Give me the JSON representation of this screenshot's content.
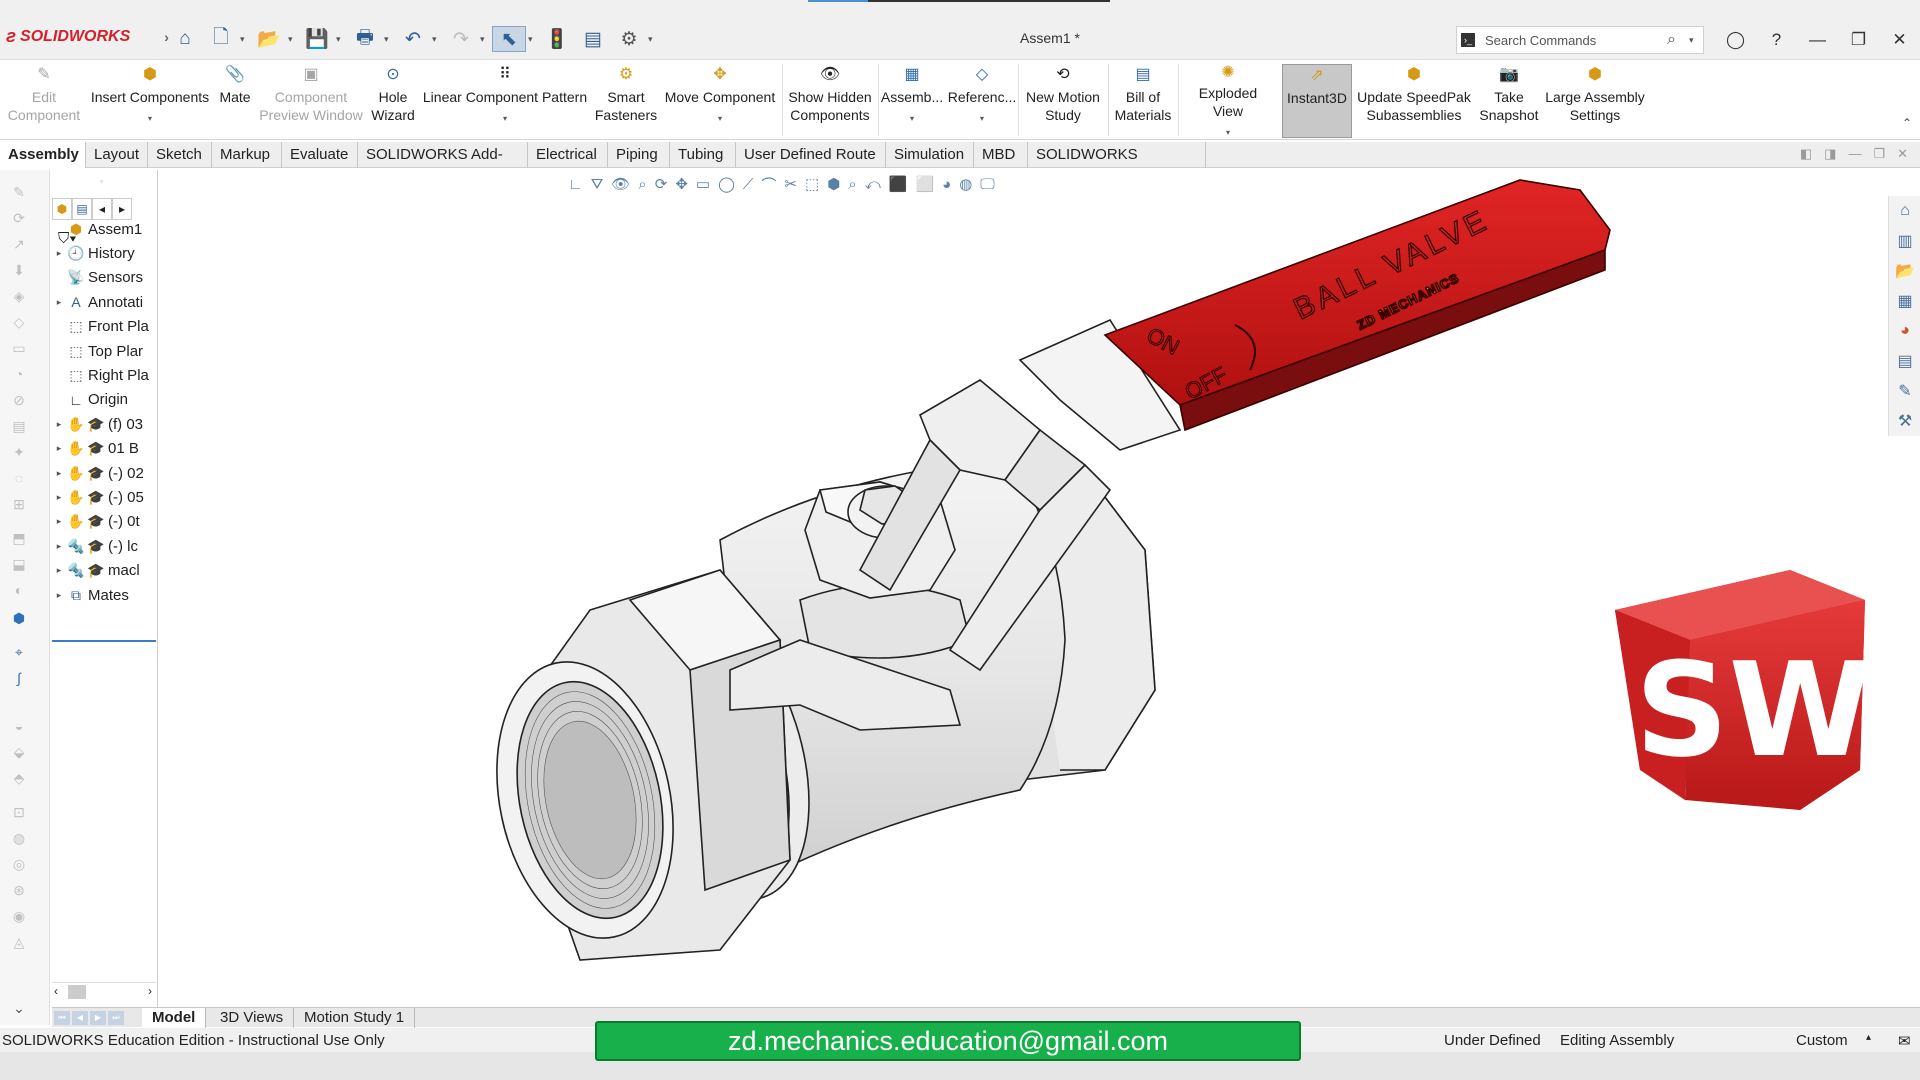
{
  "app": {
    "logo_text": "SOLIDWORKS",
    "document_title": "Assem1 *"
  },
  "search": {
    "placeholder": "Search Commands"
  },
  "command_manager": {
    "items": [
      {
        "label": "Edit\nComponent",
        "icon": "edit-component-icon",
        "enabled": false
      },
      {
        "label": "Insert Components",
        "icon": "insert-components-icon",
        "enabled": true
      },
      {
        "label": "Mate",
        "icon": "mate-icon",
        "enabled": true
      },
      {
        "label": "Component\nPreview Window",
        "icon": "preview-window-icon",
        "enabled": false
      },
      {
        "label": "Hole\nWizard",
        "icon": "hole-wizard-icon",
        "enabled": true
      },
      {
        "label": "Linear Component Pattern",
        "icon": "linear-pattern-icon",
        "enabled": true
      },
      {
        "label": "Smart\nFasteners",
        "icon": "smart-fasteners-icon",
        "enabled": true
      },
      {
        "label": "Move Component",
        "icon": "move-component-icon",
        "enabled": true
      },
      {
        "label": "Show Hidden\nComponents",
        "icon": "show-hidden-icon",
        "enabled": true
      },
      {
        "label": "Assemb...",
        "icon": "assembly-features-icon",
        "enabled": true
      },
      {
        "label": "Referenc...",
        "icon": "reference-geometry-icon",
        "enabled": true
      },
      {
        "label": "New Motion\nStudy",
        "icon": "motion-study-icon",
        "enabled": true
      },
      {
        "label": "Bill of\nMaterials",
        "icon": "bom-icon",
        "enabled": true
      },
      {
        "label": "Exploded View",
        "icon": "exploded-view-icon",
        "enabled": true
      },
      {
        "label": "Instant3D",
        "icon": "instant3d-icon",
        "enabled": true,
        "active": true
      },
      {
        "label": "Update SpeedPak\nSubassemblies",
        "icon": "speedpak-icon",
        "enabled": true
      },
      {
        "label": "Take\nSnapshot",
        "icon": "snapshot-icon",
        "enabled": true
      },
      {
        "label": "Large Assembly\nSettings",
        "icon": "large-assembly-icon",
        "enabled": true
      }
    ]
  },
  "command_tabs": [
    "Assembly",
    "Layout",
    "Sketch",
    "Markup",
    "Evaluate",
    "SOLIDWORKS Add-Ins",
    "Electrical",
    "Piping",
    "Tubing",
    "User Defined Route",
    "Simulation",
    "MBD",
    "SOLIDWORKS Visualize"
  ],
  "feature_tree": [
    {
      "label": "Assem1",
      "icon": "assembly-icon",
      "expand": false
    },
    {
      "label": "History",
      "icon": "history-icon",
      "expand": true
    },
    {
      "label": "Sensors",
      "icon": "sensors-icon",
      "expand": false
    },
    {
      "label": "Annotati",
      "icon": "annotations-icon",
      "expand": true
    },
    {
      "label": "Front Pla",
      "icon": "plane-icon",
      "expand": false
    },
    {
      "label": "Top Plar",
      "icon": "plane-icon",
      "expand": false
    },
    {
      "label": "Right Pla",
      "icon": "plane-icon",
      "expand": false
    },
    {
      "label": "Origin",
      "icon": "origin-icon",
      "expand": false
    },
    {
      "label": "(f) 03",
      "icon": "part-icon",
      "expand": true
    },
    {
      "label": "01 B",
      "icon": "part-icon",
      "expand": true
    },
    {
      "label": "(-) 02",
      "icon": "part-icon",
      "expand": true
    },
    {
      "label": "(-) 05",
      "icon": "part-icon",
      "expand": true
    },
    {
      "label": "(-) 0t",
      "icon": "part-icon",
      "expand": true
    },
    {
      "label": "(-) lc",
      "icon": "fastener-icon",
      "expand": true
    },
    {
      "label": "macl",
      "icon": "fastener-icon",
      "expand": true
    },
    {
      "label": "Mates",
      "icon": "mates-icon",
      "expand": true
    }
  ],
  "model": {
    "handle_text_1": "BALL VALVE",
    "handle_text_2": "ZD MECHANICS",
    "on_label": "ON",
    "off_label": "OFF",
    "handle_color": "#d21b1b",
    "logo_letters": "SW"
  },
  "bottom_tabs": [
    "Model",
    "3D Views",
    "Motion Study 1"
  ],
  "status": {
    "left": "SOLIDWORKS Education Edition - Instructional Use Only",
    "state": "Under Defined",
    "mode": "Editing Assembly",
    "units": "Custom"
  },
  "overlay_email": "zd.mechanics.education@gmail.com"
}
